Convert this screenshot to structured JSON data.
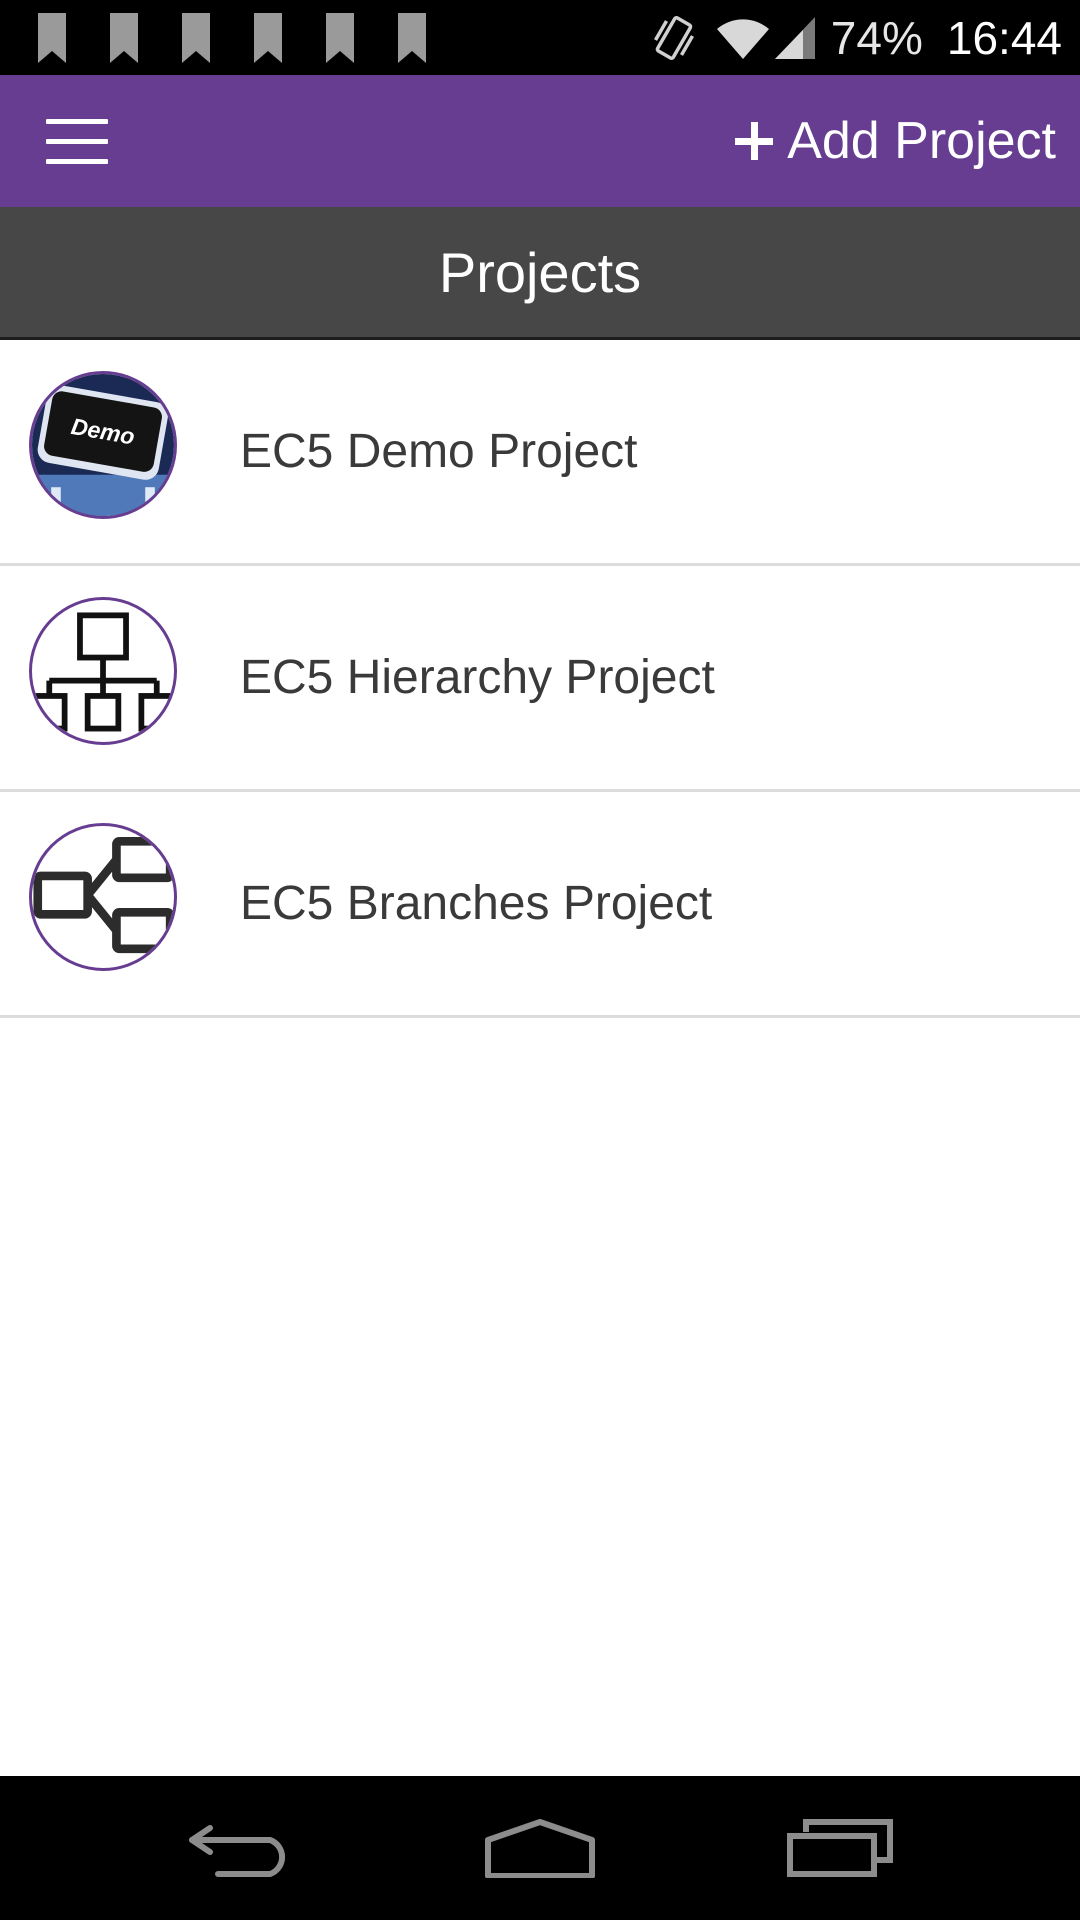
{
  "status_bar": {
    "notification_count": 6,
    "notification_icon": "bookmark-icon",
    "icons": [
      "vibrate-icon",
      "wifi-icon",
      "signal-icon"
    ],
    "battery": "74%",
    "time": "16:44"
  },
  "app_bar": {
    "menu_icon": "hamburger-menu-icon",
    "add_icon": "plus-icon",
    "add_label": "Add Project",
    "color": "#673d91"
  },
  "header": {
    "title": "Projects"
  },
  "projects": [
    {
      "name": "EC5 Demo Project",
      "icon": "demo-keyboard-key-icon",
      "icon_text": "Demo"
    },
    {
      "name": "EC5 Hierarchy Project",
      "icon": "hierarchy-icon"
    },
    {
      "name": "EC5 Branches Project",
      "icon": "branches-icon"
    }
  ],
  "nav_bar": {
    "buttons": [
      "back-icon",
      "home-icon",
      "recents-icon"
    ]
  }
}
